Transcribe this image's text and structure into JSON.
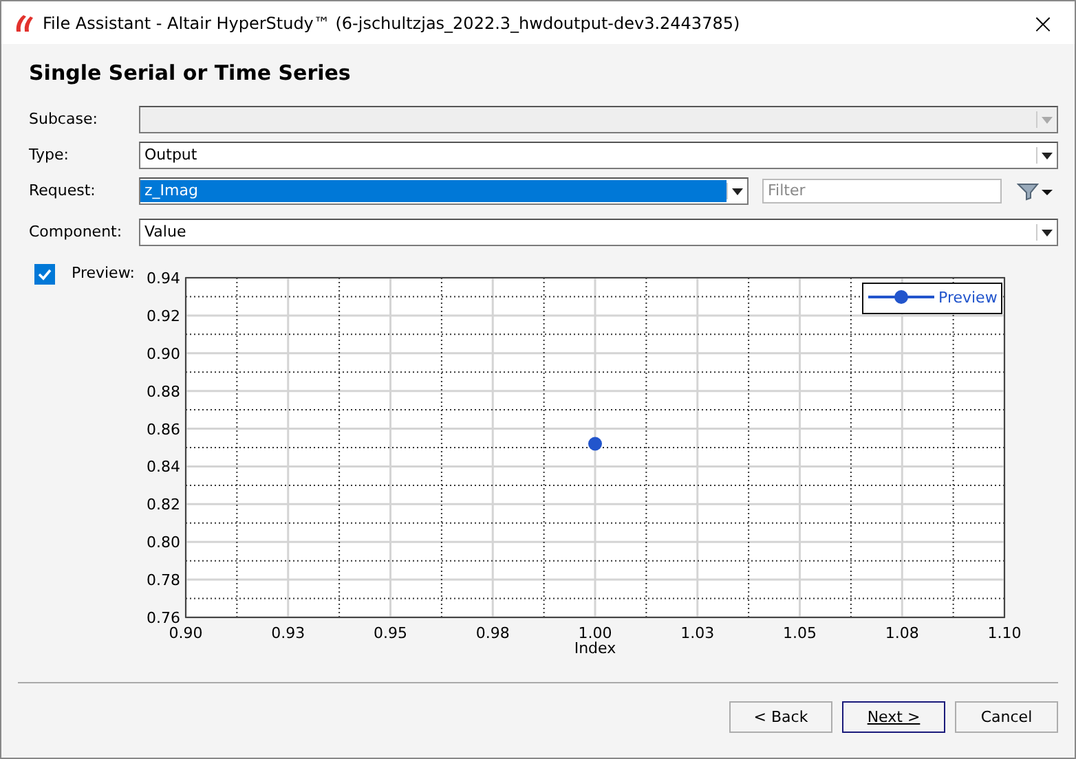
{
  "window": {
    "title": "File Assistant - Altair HyperStudy™ (6-jschultzjas_2022.3_hwdoutput-dev3.2443785)",
    "close": "×"
  },
  "heading": "Single Serial or Time Series",
  "fields": [
    {
      "label": "Subcase:",
      "disabled": true,
      "selected": false
    },
    {
      "label": "Type:",
      "value": "Output",
      "disabled": false,
      "selected": false
    },
    {
      "label": "Request:",
      "value": "z_Imag",
      "disabled": false,
      "selected": true,
      "filter_placeholder": "Filter"
    },
    {
      "label": "Component:",
      "value": "Value",
      "disabled": false,
      "selected": false
    }
  ],
  "preview": {
    "label": "Preview:",
    "checked": true
  },
  "chart": {
    "chart_data": {
      "type": "scatter",
      "xlabel": "Index",
      "x": [
        1.0
      ],
      "series": [
        {
          "name": "Preview",
          "color": "#2255cc",
          "values": [
            0.852
          ]
        }
      ],
      "grid": true,
      "xlim": [
        0.9,
        1.1
      ],
      "ylim": [
        0.76,
        0.94
      ],
      "xticks": [
        {
          "value": 0.9,
          "label": "0.90"
        },
        {
          "value": 0.925,
          "label": "0.93"
        },
        {
          "value": 0.95,
          "label": "0.95"
        },
        {
          "value": 0.975,
          "label": "0.98"
        },
        {
          "value": 1.0,
          "label": "1.00"
        },
        {
          "value": 1.025,
          "label": "1.03"
        },
        {
          "value": 1.05,
          "label": "1.05"
        },
        {
          "value": 1.075,
          "label": "1.08"
        },
        {
          "value": 1.1,
          "label": "1.10"
        }
      ],
      "yticks": [
        {
          "value": 0.76,
          "label": "0.76"
        },
        {
          "value": 0.78,
          "label": "0.78"
        },
        {
          "value": 0.8,
          "label": "0.80"
        },
        {
          "value": 0.82,
          "label": "0.82"
        },
        {
          "value": 0.84,
          "label": "0.84"
        },
        {
          "value": 0.86,
          "label": "0.86"
        },
        {
          "value": 0.88,
          "label": "0.88"
        },
        {
          "value": 0.9,
          "label": "0.90"
        },
        {
          "value": 0.92,
          "label": "0.92"
        },
        {
          "value": 0.94,
          "label": "0.94"
        }
      ]
    }
  },
  "buttons": [
    {
      "label": "< Back",
      "default": false
    },
    {
      "label": "Next >",
      "default": true
    },
    {
      "label": "Cancel",
      "default": false
    }
  ]
}
